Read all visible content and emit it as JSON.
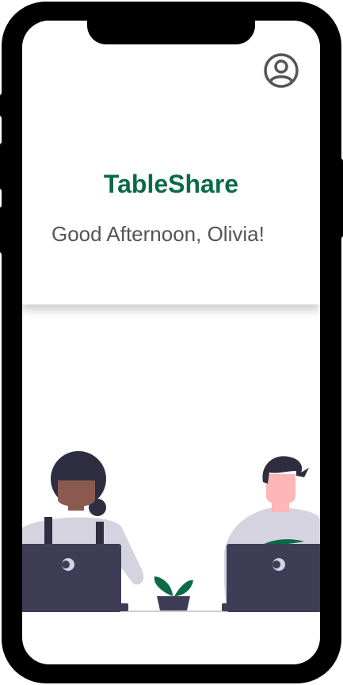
{
  "app": {
    "title": "TableShare",
    "greeting": "Good Afternoon, Olivia!"
  },
  "icons": {
    "profile": "user-circle-icon"
  },
  "colors": {
    "brand": "#0a6a46",
    "greeting_text": "#555555",
    "laptop": "#3f3d56",
    "shirt": "#d6d3e0",
    "skin_dark": "#8b5a4f",
    "skin_light": "#ffb6b6",
    "hair": "#2f2e41",
    "leaf": "#0a6a46"
  }
}
